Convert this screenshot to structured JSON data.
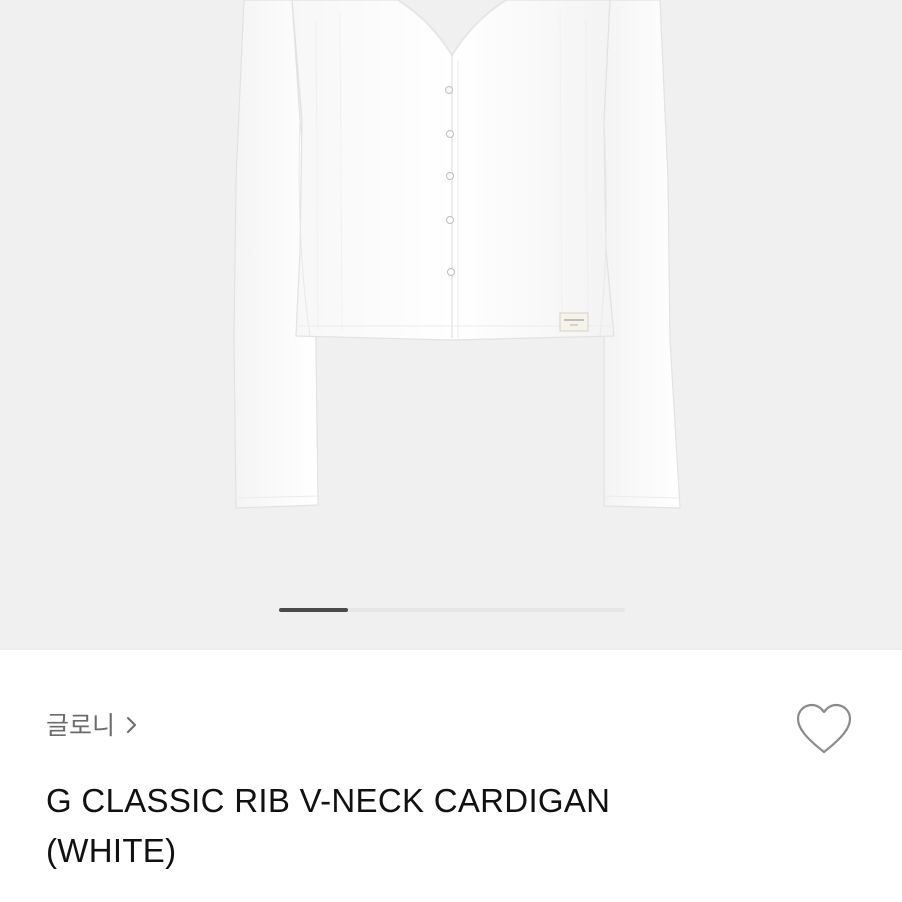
{
  "gallery": {
    "image_alt": "G CLASSIC RIB V-NECK CARDIGAN (WHITE)",
    "label_text": "GLORNY",
    "current_slide": 1,
    "total_slides": 5
  },
  "product": {
    "brand": "글로니",
    "title_line1": "G CLASSIC RIB V-NECK CARDIGAN",
    "title_line2": "(WHITE)"
  },
  "icons": {
    "brand_chevron": "chevron-right-icon",
    "wishlist": "heart-outline-icon"
  },
  "colors": {
    "gallery_bg": "#f0f0f0",
    "pager_active": "#4a4a4a",
    "pager_track": "#e6e6e6",
    "brand_text": "#6b6b6b",
    "title_text": "#111111"
  }
}
